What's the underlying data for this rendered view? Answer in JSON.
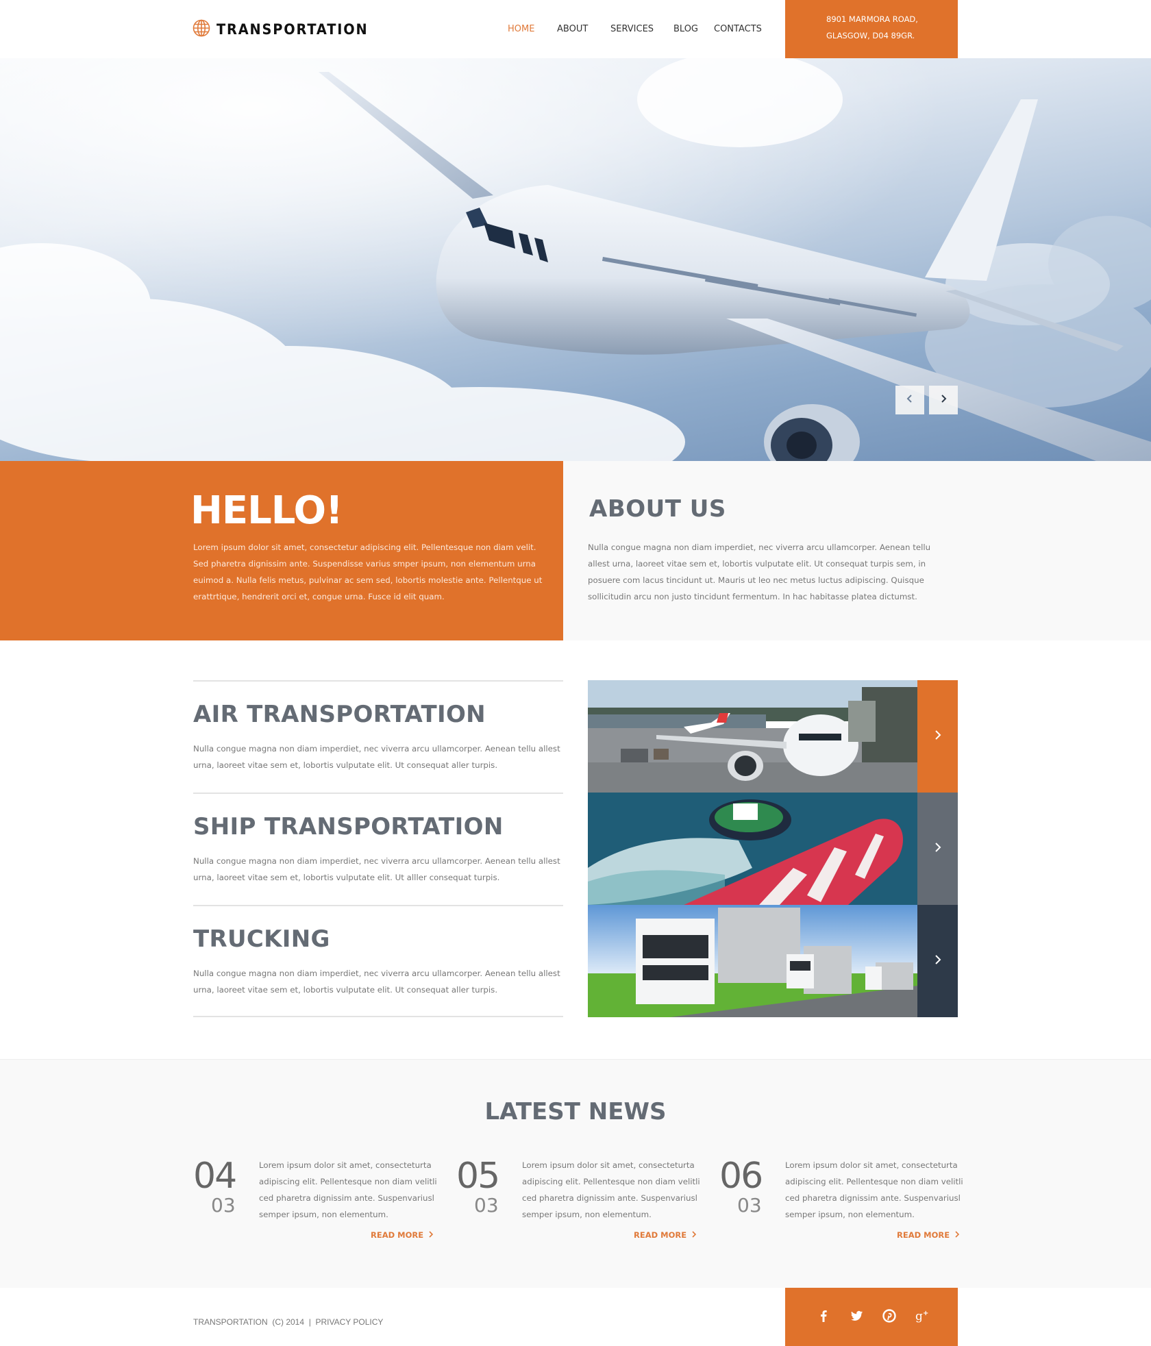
{
  "header": {
    "logo_text": "TRANSPORTATION",
    "logo_icon": "globe-icon",
    "nav": [
      {
        "label": "HOME",
        "active": true
      },
      {
        "label": "ABOUT",
        "active": false
      },
      {
        "label": "SERVICES",
        "active": false
      },
      {
        "label": "BLOG",
        "active": false
      },
      {
        "label": "CONTACTS",
        "active": false
      }
    ],
    "address_line1": "8901 MARMORA ROAD,",
    "address_line2": "GLASGOW, D04 89GR."
  },
  "hero": {
    "image": "airplane-in-clouds",
    "prev_icon": "chevron-left-icon",
    "next_icon": "chevron-right-icon"
  },
  "hello": {
    "title": "HELLO!",
    "text": "Lorem ipsum dolor sit amet, consectetur adipiscing elit. Pellentesque non diam velit. Sed pharetra dignissim ante. Suspendisse varius smper ipsum, non elementum urna euimod a. Nulla felis metus, pulvinar ac sem sed, lobortis molestie ante. Pellentque ut erattrtique, hendrerit orci et, congue urna. Fusce id elit quam."
  },
  "about": {
    "title": "ABOUT US",
    "text": "Nulla congue magna non diam imperdiet, nec viverra arcu ullamcorper. Aenean tellu allest urna, laoreet vitae sem et, lobortis vulputate elit. Ut consequat turpis sem, in posuere com lacus tincidunt ut. Mauris ut leo nec metus luctus adipiscing. Quisque sollicitudin arcu non justo tincidunt fermentum. In hac habitasse platea dictumst."
  },
  "services": [
    {
      "title": "AIR TRANSPORTATION",
      "text": "Nulla congue magna non diam imperdiet, nec viverra arcu ullamcorper. Aenean tellu allest urna, laoreet vitae sem et, lobortis vulputate elit. Ut consequat aller turpis.",
      "image": "airport-plane",
      "arrow_color": "#e0722b"
    },
    {
      "title": "SHIP TRANSPORTATION",
      "text": "Nulla congue magna non diam imperdiet, nec viverra arcu ullamcorper. Aenean tellu allest urna, laoreet vitae sem et, lobortis vulputate elit. Ut alller consequat turpis.",
      "image": "cargo-ship-tugboat",
      "arrow_color": "#646b74"
    },
    {
      "title": "TRUCKING",
      "text": "Nulla congue magna non diam imperdiet, nec viverra arcu ullamcorper. Aenean tellu allest urna, laoreet vitae sem et, lobortis vulputate elit. Ut consequat aller turpis.",
      "image": "trucks-on-road",
      "arrow_color": "#2e3a49"
    }
  ],
  "news": {
    "title": "LATEST NEWS",
    "items": [
      {
        "day": "04",
        "month": "03",
        "text": "Lorem ipsum dolor sit amet, consecteturta adipiscing elit. Pellentesque non diam velitli ced pharetra dignissim ante. Suspenvariusl semper ipsum, non elementum.",
        "read_more": "READ MORE"
      },
      {
        "day": "05",
        "month": "03",
        "text": "Lorem ipsum dolor sit amet, consecteturta adipiscing elit. Pellentesque non diam velitli ced pharetra dignissim ante. Suspenvariusl semper ipsum, non elementum.",
        "read_more": "READ MORE"
      },
      {
        "day": "06",
        "month": "03",
        "text": "Lorem ipsum dolor sit amet, consecteturta adipiscing elit. Pellentesque non diam velitli ced pharetra dignissim ante. Suspenvariusl semper ipsum, non elementum.",
        "read_more": "READ MORE"
      }
    ]
  },
  "footer": {
    "copyright": "TRANSPORTATION  (C) 2014  |  ",
    "privacy": "PRIVACY POLICY",
    "social": [
      "facebook-icon",
      "twitter-icon",
      "pinterest-icon",
      "google-plus-icon"
    ]
  },
  "colors": {
    "accent": "#e0722b",
    "heading": "#646b74",
    "dark": "#2e3a49",
    "body_text": "#777777",
    "light_bg": "#f9f9f9"
  }
}
